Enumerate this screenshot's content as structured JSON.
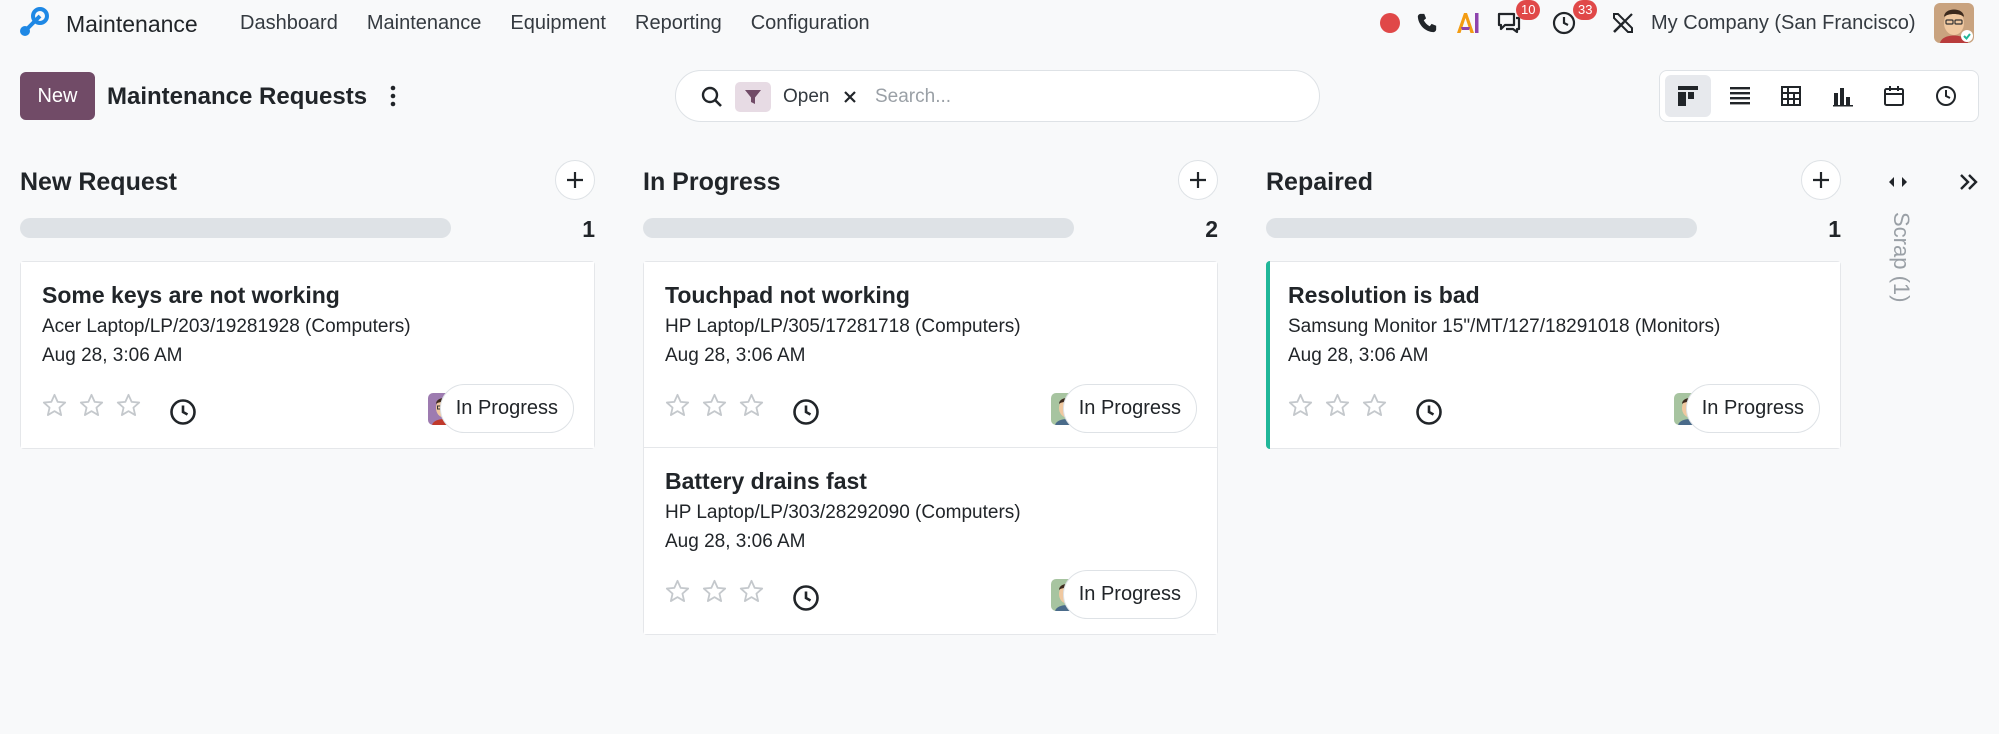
{
  "app": {
    "name": "Maintenance",
    "menu": [
      "Dashboard",
      "Maintenance",
      "Equipment",
      "Reporting",
      "Configuration"
    ]
  },
  "systray": {
    "messages_badge": "10",
    "activities_badge": "33",
    "company": "My Company (San Francisco)",
    "icons": [
      "record-icon",
      "phone-icon",
      "ai-icon",
      "chat-icon",
      "clock-icon",
      "tools-icon"
    ]
  },
  "control_panel": {
    "new_label": "New",
    "title": "Maintenance Requests",
    "facet_label": "Open",
    "search_placeholder": "Search...",
    "views": [
      "kanban",
      "list",
      "pivot",
      "graph",
      "calendar",
      "activity"
    ]
  },
  "colors": {
    "brand": "#714b67",
    "facet_bg": "#e7dbe4",
    "accent_green": "#21b799",
    "badge_red": "#e04848"
  },
  "columns": [
    {
      "title": "New Request",
      "count": "1",
      "cards": [
        {
          "title": "Some keys are not working",
          "equipment": "Acer Laptop/LP/203/19281928 (Computers)",
          "date": "Aug 28, 3:06 AM",
          "state": "In Progress",
          "rating": 0,
          "accent": false
        }
      ]
    },
    {
      "title": "In Progress",
      "count": "2",
      "cards": [
        {
          "title": "Touchpad not working",
          "equipment": "HP Laptop/LP/305/17281718 (Computers)",
          "date": "Aug 28, 3:06 AM",
          "state": "In Progress",
          "rating": 0,
          "accent": false
        },
        {
          "title": "Battery drains fast",
          "equipment": "HP Laptop/LP/303/28292090 (Computers)",
          "date": "Aug 28, 3:06 AM",
          "state": "In Progress",
          "rating": 0,
          "accent": false
        }
      ]
    },
    {
      "title": "Repaired",
      "count": "1",
      "cards": [
        {
          "title": "Resolution is bad",
          "equipment": "Samsung Monitor 15\"/MT/127/18291018 (Monitors)",
          "date": "Aug 28, 3:06 AM",
          "state": "In Progress",
          "rating": 0,
          "accent": true
        }
      ]
    }
  ],
  "folded_column": {
    "label": "Scrap (1)"
  }
}
